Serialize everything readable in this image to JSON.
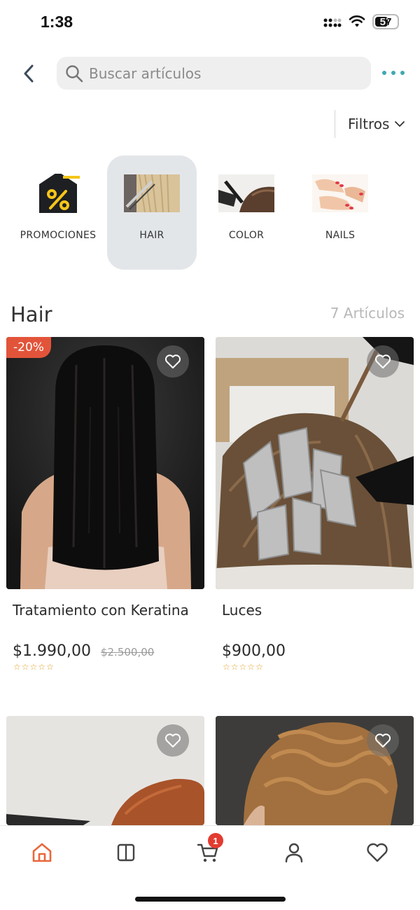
{
  "status_bar": {
    "time": "1:38",
    "battery": "57"
  },
  "search": {
    "placeholder": "Buscar artículos"
  },
  "filters": {
    "label": "Filtros"
  },
  "categories": [
    {
      "label": "PROMOCIONES",
      "icon": "percent-tag-icon",
      "active": false
    },
    {
      "label": "HAIR",
      "icon": "hair-image",
      "active": true
    },
    {
      "label": "COLOR",
      "icon": "color-image",
      "active": false
    },
    {
      "label": "NAILS",
      "icon": "nails-image",
      "active": false
    }
  ],
  "section": {
    "title": "Hair",
    "count": "7 Artículos"
  },
  "products": [
    {
      "name": "Tratamiento con Keratina",
      "price": "$1.990,00",
      "old_price": "$2.500,00",
      "discount": "-20%",
      "rating": 0
    },
    {
      "name": "Luces",
      "price": "$900,00",
      "old_price": "",
      "discount": "",
      "rating": 0
    },
    {
      "name": "",
      "price": "",
      "old_price": "",
      "discount": "",
      "rating": 0
    },
    {
      "name": "",
      "price": "",
      "old_price": "",
      "discount": "",
      "rating": 0
    }
  ],
  "bottom_nav": {
    "items": [
      "home-icon",
      "catalog-icon",
      "cart-icon",
      "profile-icon",
      "favorites-icon"
    ],
    "cart_badge": "1",
    "active_color": "#e8683c"
  },
  "colors": {
    "accent": "#3fa8b0",
    "discount": "#e2543a",
    "star": "#e0a126",
    "badge": "#e33b30"
  }
}
